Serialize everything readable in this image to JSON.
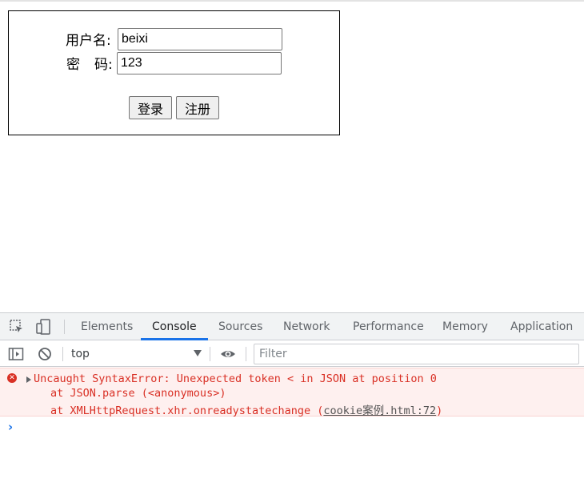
{
  "login_form": {
    "username_label": "用户名:",
    "password_label_a": "密",
    "password_label_b": "码:",
    "username_value": "beixi",
    "password_value": "123",
    "login_button": "登录",
    "register_button": "注册"
  },
  "devtools": {
    "tabs": [
      {
        "label": "Elements",
        "active": false
      },
      {
        "label": "Console",
        "active": true
      },
      {
        "label": "Sources",
        "active": false
      },
      {
        "label": "Network",
        "active": false
      },
      {
        "label": "Performance",
        "active": false
      },
      {
        "label": "Memory",
        "active": false
      },
      {
        "label": "Application",
        "active": false
      }
    ],
    "context": "top",
    "filter_placeholder": "Filter",
    "error": {
      "line1": "Uncaught SyntaxError: Unexpected token < in JSON at position 0",
      "line2": "at JSON.parse (<anonymous>)",
      "line3_prefix": "at XMLHttpRequest.xhr.onreadystatechange (",
      "line3_link": "cookie案例.html:72",
      "line3_suffix": ")"
    },
    "colors": {
      "accent": "#1a73e8",
      "error_text": "#d93025",
      "error_bg": "#fef0ef"
    },
    "icons": [
      "inspect-element-icon",
      "device-toolbar-icon",
      "console-sidebar-icon",
      "clear-console-icon",
      "eye-icon",
      "error-icon",
      "expand-triangle-icon",
      "prompt-chevron-icon"
    ]
  }
}
